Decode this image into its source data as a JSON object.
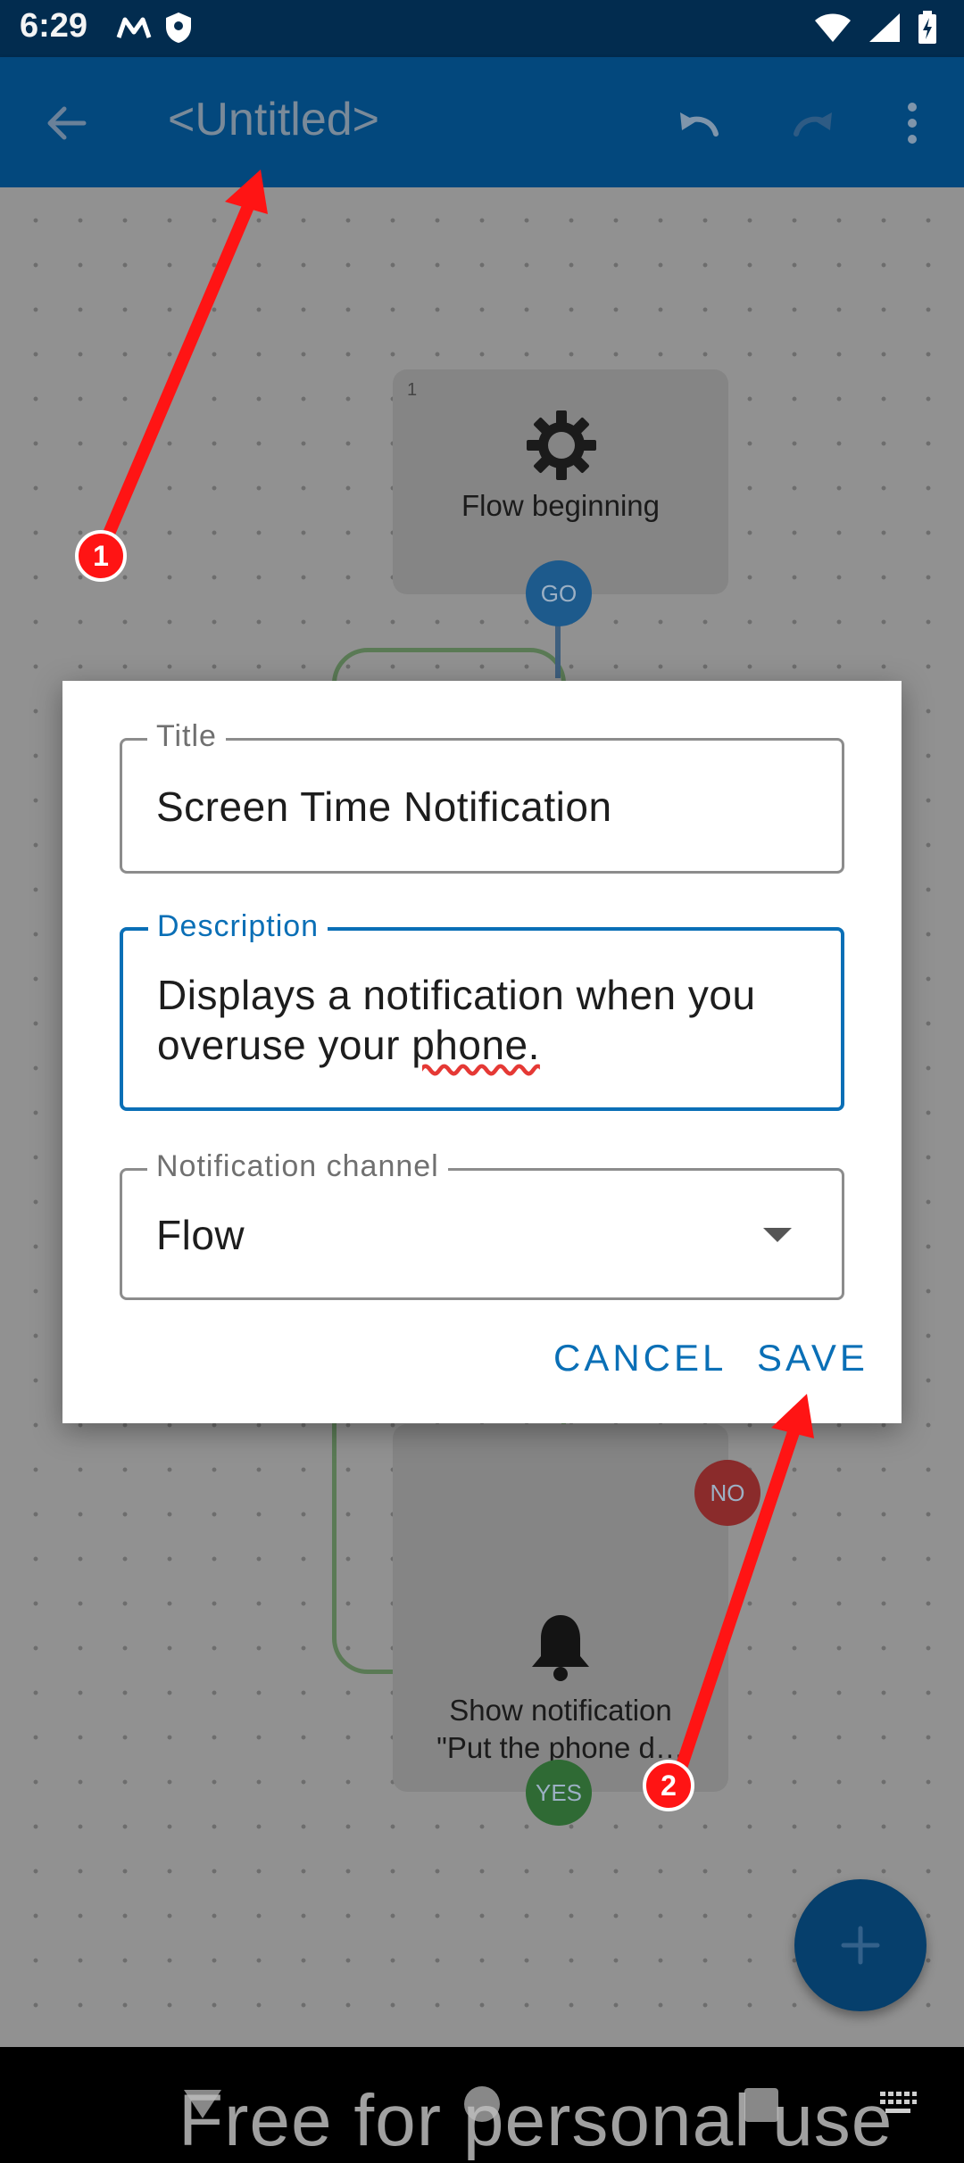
{
  "status_bar": {
    "time": "6:29",
    "icons": [
      "motorola-icon",
      "shield-icon",
      "wifi-icon",
      "signal-icon",
      "battery-charging-icon"
    ]
  },
  "app_bar": {
    "title": "<Untitled>",
    "icons": [
      "back-arrow-icon",
      "undo-icon",
      "redo-icon",
      "more-vert-icon"
    ]
  },
  "canvas": {
    "nodes": [
      {
        "index": "1",
        "label": "Flow beginning",
        "icon": "gear-icon"
      },
      {
        "index": "",
        "label_line1": "Show notification",
        "label_line2": "\"Put the phone d…",
        "icon": "bell-icon"
      }
    ],
    "badges": {
      "go": "GO",
      "no": "NO",
      "yes": "YES"
    }
  },
  "dialog": {
    "title_field": {
      "label": "Title",
      "value": "Screen Time Notification"
    },
    "description_field": {
      "label": "Description",
      "line1": "Displays a notification when you",
      "line2_prefix": "overuse your ",
      "line2_underlined": "phone."
    },
    "channel_field": {
      "label": "Notification channel",
      "value": "Flow"
    },
    "cancel_label": "CANCEL",
    "save_label": "SAVE"
  },
  "fab": {
    "icon": "plus-icon"
  },
  "nav_bar": {
    "watermark": "Free for personal use",
    "icons": [
      "back-triangle-icon",
      "home-circle-icon",
      "recents-square-icon",
      "keyboard-icon"
    ]
  },
  "annotations": {
    "marker_1": "1",
    "marker_2": "2"
  },
  "colors": {
    "app_bar": "#03487d",
    "status_bar": "#022c4f",
    "accent": "#0a6fb6",
    "annotation_red": "#ff1414"
  }
}
